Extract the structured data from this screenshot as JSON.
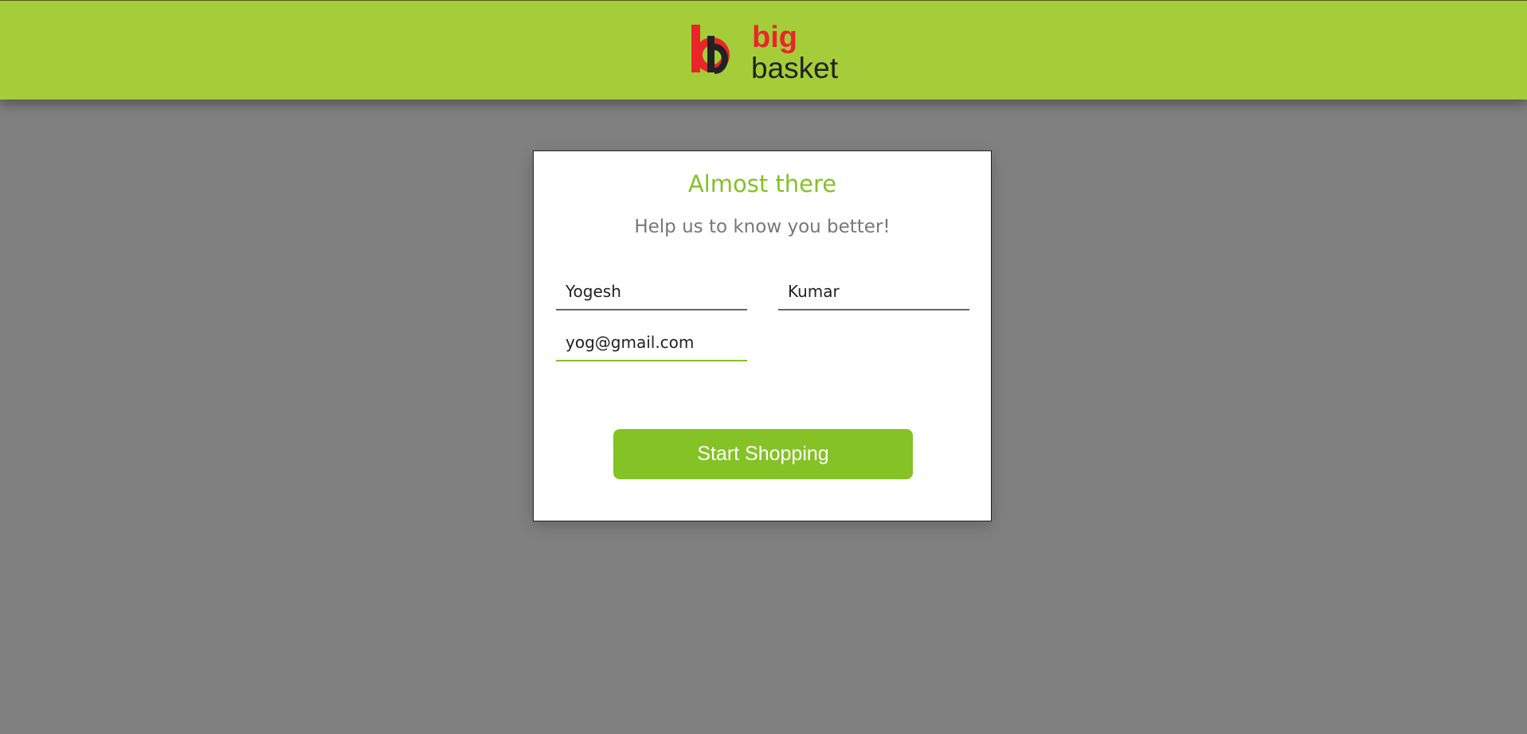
{
  "header": {
    "brand_big": "big",
    "brand_basket": "basket",
    "logo_icon": "bigbasket-bb-logo",
    "colors": {
      "bar": "#a5cd39",
      "logo_red": "#e8262a",
      "logo_dark": "#222222"
    }
  },
  "form": {
    "title": "Almost there",
    "subtitle": "Help us to know you better!",
    "first_name_value": "Yogesh",
    "last_name_value": "Kumar",
    "email_value": "yog@gmail.com",
    "submit_label": "Start Shopping",
    "colors": {
      "accent": "#84c225",
      "background": "#808080"
    }
  }
}
